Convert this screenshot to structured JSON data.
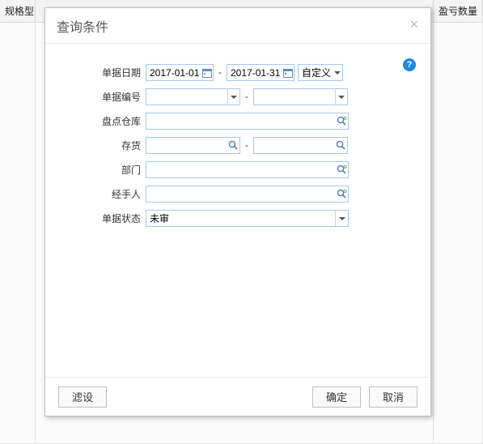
{
  "grid": {
    "col_spec_model": "规格型号",
    "col_qty": "盈亏数量"
  },
  "modal": {
    "title": "查询条件",
    "labels": {
      "date": "单据日期",
      "doc_no": "单据编号",
      "warehouse": "盘点仓库",
      "inventory": "存货",
      "department": "部门",
      "handler": "经手人",
      "status": "单据状态"
    },
    "values": {
      "date_from": "2017-01-01",
      "date_to": "2017-01-31",
      "date_mode": "自定义",
      "doc_no_from": "",
      "doc_no_to": "",
      "warehouse": "",
      "inventory_from": "",
      "inventory_to": "",
      "department": "",
      "handler": "",
      "status": "未审"
    },
    "buttons": {
      "filter": "滤设",
      "ok": "确定",
      "cancel": "取消"
    }
  }
}
